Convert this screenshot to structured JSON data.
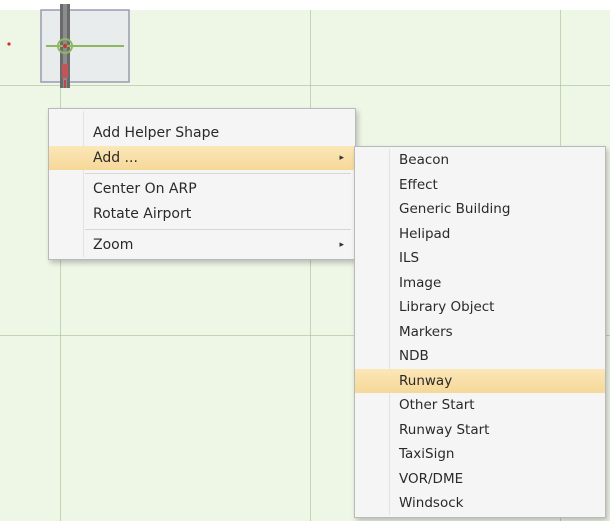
{
  "context_menu": {
    "items": [
      {
        "label": "Add Helper Shape"
      },
      {
        "label": "Add ...",
        "submenu_arrow": "▸"
      },
      {
        "label": "Center On ARP"
      },
      {
        "label": "Rotate Airport"
      },
      {
        "label": "Zoom",
        "submenu_arrow": "▸"
      }
    ]
  },
  "add_submenu": {
    "items": [
      {
        "label": "Beacon"
      },
      {
        "label": "Effect"
      },
      {
        "label": "Generic Building"
      },
      {
        "label": "Helipad"
      },
      {
        "label": "ILS"
      },
      {
        "label": "Image"
      },
      {
        "label": "Library Object"
      },
      {
        "label": "Markers"
      },
      {
        "label": "NDB"
      },
      {
        "label": "Runway"
      },
      {
        "label": "Other Start"
      },
      {
        "label": "Runway Start"
      },
      {
        "label": "TaxiSign"
      },
      {
        "label": "VOR/DME"
      },
      {
        "label": "Windsock"
      }
    ]
  },
  "colors": {
    "canvas_background": "#eef6e6",
    "highlight": "#f6d898",
    "menu_background": "#f5f5f5"
  }
}
